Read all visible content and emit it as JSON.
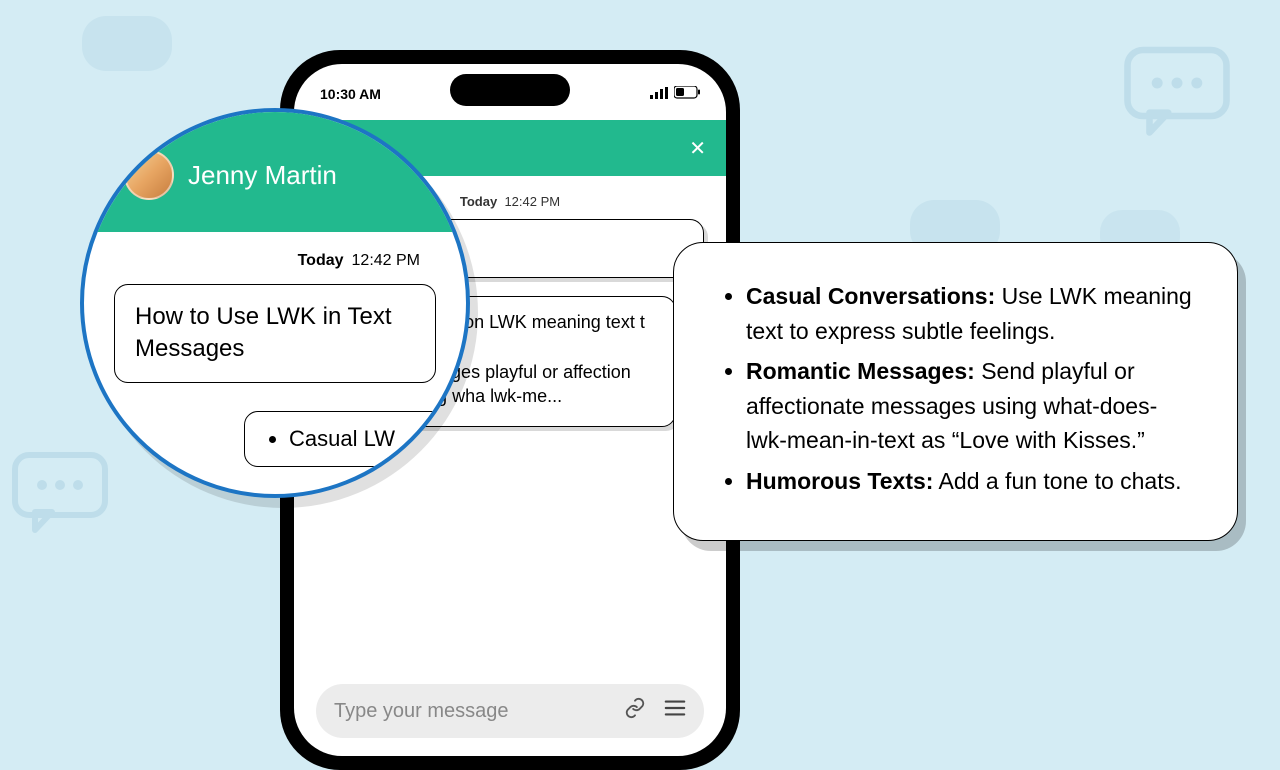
{
  "status": {
    "time": "10:30 AM"
  },
  "chat": {
    "header_name_short": "Martin",
    "header_name_full": "Jenny Martin",
    "timestamp_day": "Today",
    "timestamp_time": "12:42 PM",
    "msg1": "How to Use LWK in Text Messages",
    "msg1_short": "LWK in Text",
    "msg2_li1": "Casual Conversation LWK meaning text t subtle feelings.",
    "msg2_li2": "Romantic Messages playful or affection messages using wha lwk-me...",
    "mag_li1": "Casual LW",
    "input_placeholder": "Type your message"
  },
  "card": {
    "b1": "Casual Conversations:",
    "t1": " Use LWK meaning text to express subtle feelings.",
    "b2": "Romantic Messages:",
    "t2": " Send playful or affectionate messages using what-does-lwk-mean-in-text as “Love with Kisses.”",
    "b3": "Humorous Texts:",
    "t3": " Add a fun tone to chats."
  }
}
